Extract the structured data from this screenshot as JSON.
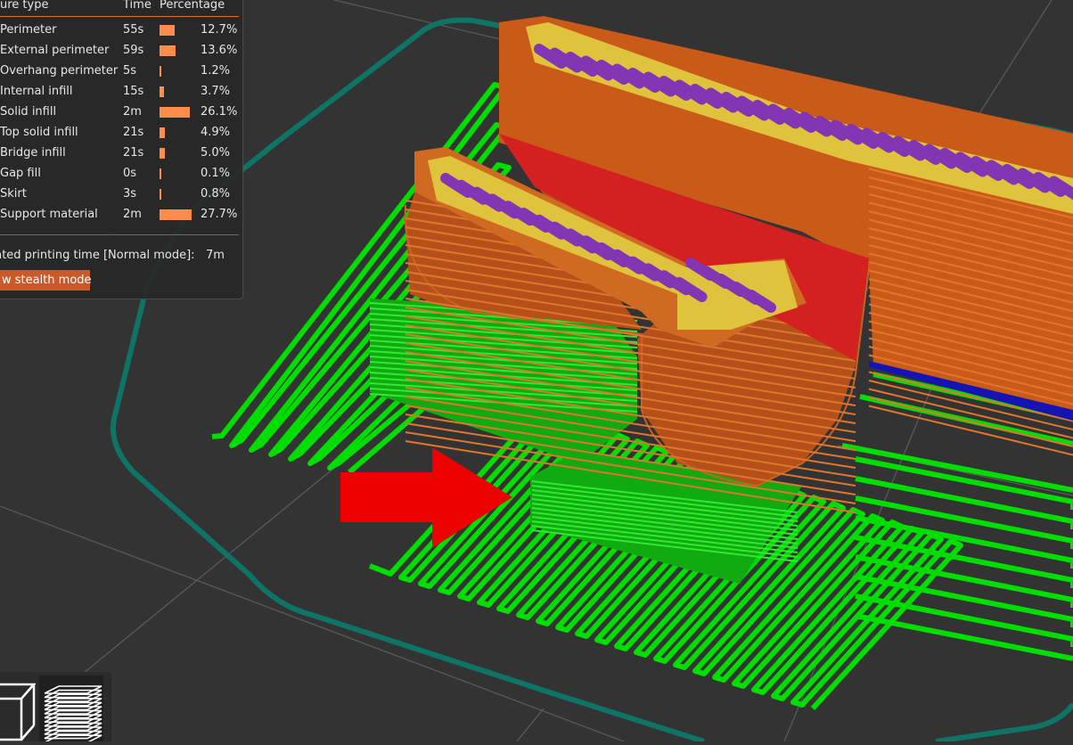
{
  "legend": {
    "headers": {
      "feature_type": "ure type",
      "time": "Time",
      "percentage": "Percentage"
    },
    "rows": [
      {
        "name": "Perimeter",
        "time": "55s",
        "pct": "12.7%",
        "share": 0.127
      },
      {
        "name": "External perimeter",
        "time": "59s",
        "pct": "13.6%",
        "share": 0.136
      },
      {
        "name": "Overhang perimeter",
        "time": "5s",
        "pct": "1.2%",
        "share": 0.012
      },
      {
        "name": "Internal infill",
        "time": "15s",
        "pct": "3.7%",
        "share": 0.037
      },
      {
        "name": "Solid infill",
        "time": "2m",
        "pct": "26.1%",
        "share": 0.261
      },
      {
        "name": "Top solid infill",
        "time": "21s",
        "pct": "4.9%",
        "share": 0.049
      },
      {
        "name": "Bridge infill",
        "time": "21s",
        "pct": "5.0%",
        "share": 0.05
      },
      {
        "name": "Gap fill",
        "time": "0s",
        "pct": "0.1%",
        "share": 0.001
      },
      {
        "name": "Skirt",
        "time": "3s",
        "pct": "0.8%",
        "share": 0.008
      },
      {
        "name": "Support material",
        "time": "2m",
        "pct": "27.7%",
        "share": 0.277
      }
    ],
    "estimated_label": "nated printing time [Normal mode]:",
    "estimated_value": "7m",
    "stealth_button": "w stealth mode"
  },
  "toolbar": {
    "view_3d_icon": "cube-outline-icon",
    "layers_icon": "layers-stack-icon"
  },
  "colors": {
    "background": "#333333",
    "skirt": "#0e7466",
    "support": "#00dd00",
    "perimeter": "#e0681d",
    "external_perimeter": "#e0c33d",
    "solid_infill": "#8236b3",
    "bridge_infill": "#1414b4",
    "overhang_perimeter": "#d42020",
    "bar": "#ff8c4b",
    "accent": "#ed6b21",
    "arrow": "#ee0000"
  }
}
